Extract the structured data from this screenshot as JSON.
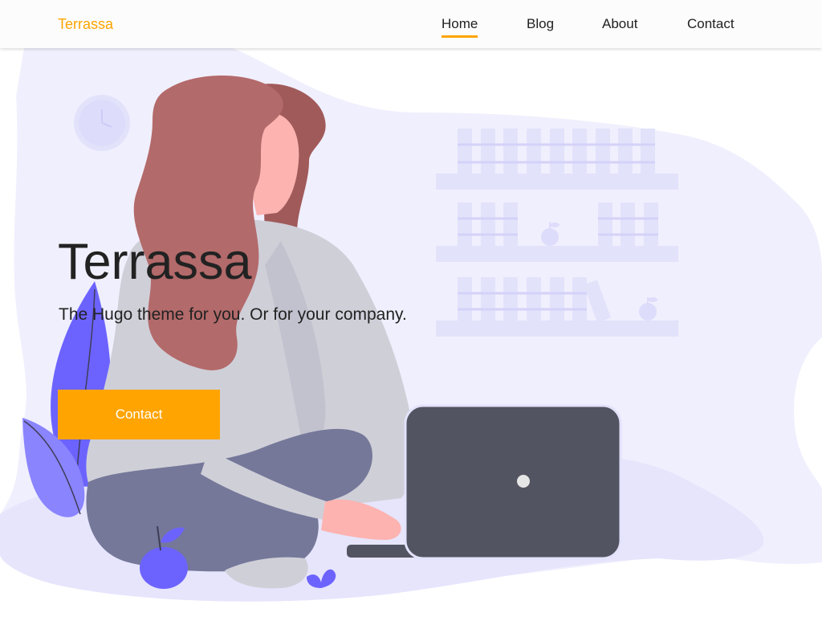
{
  "header": {
    "brand": "Terrassa",
    "nav": [
      {
        "label": "Home",
        "active": true
      },
      {
        "label": "Blog",
        "active": false
      },
      {
        "label": "About",
        "active": false
      },
      {
        "label": "Contact",
        "active": false
      }
    ]
  },
  "hero": {
    "title": "Terrassa",
    "subtitle": "The Hugo theme for you. Or for your company.",
    "cta_label": "Contact"
  },
  "colors": {
    "accent": "#ffa400",
    "text": "#222222",
    "blob": "#f0effd",
    "shelf": "#e3e2fb",
    "plant": "#6c63ff",
    "hair": "#b36a6a",
    "skin": "#fdb3b0",
    "sweater": "#cfcfd8",
    "pants": "#757899",
    "laptop": "#535461"
  },
  "icons": {
    "illustration": "woman-with-laptop-illustration",
    "clock": "clock-icon",
    "apple": "apple-icon",
    "plant": "plant-icon"
  }
}
